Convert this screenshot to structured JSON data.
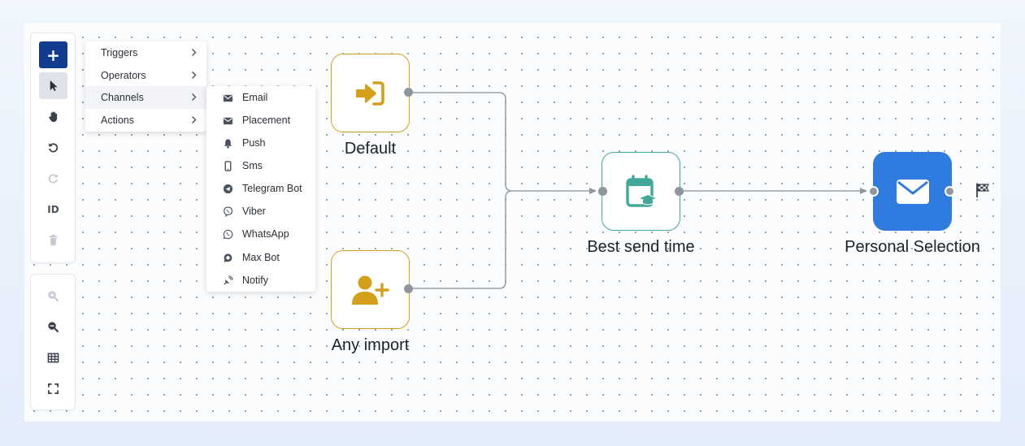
{
  "toolbar": {
    "add_label": "+",
    "id_label": "ID",
    "tools": [
      "add-icon",
      "pointer-icon",
      "hand-icon",
      "undo-icon",
      "redo-icon",
      "id-icon",
      "trash-icon"
    ],
    "view_tools": [
      "zoom-in-icon",
      "zoom-out-icon",
      "grid-icon",
      "fullscreen-icon"
    ]
  },
  "menu": {
    "items": [
      {
        "label": "Triggers"
      },
      {
        "label": "Operators"
      },
      {
        "label": "Channels"
      },
      {
        "label": "Actions"
      }
    ],
    "active_item": "Channels"
  },
  "submenu": {
    "items": [
      {
        "label": "Email",
        "icon": "envelope-icon"
      },
      {
        "label": "Placement",
        "icon": "envelope-icon"
      },
      {
        "label": "Push",
        "icon": "bell-icon"
      },
      {
        "label": "Sms",
        "icon": "phone-icon"
      },
      {
        "label": "Telegram Bot",
        "icon": "telegram-icon"
      },
      {
        "label": "Viber",
        "icon": "viber-icon"
      },
      {
        "label": "WhatsApp",
        "icon": "whatsapp-icon"
      },
      {
        "label": "Max Bot",
        "icon": "chat-bubble-icon"
      },
      {
        "label": "Notify",
        "icon": "satellite-icon"
      }
    ]
  },
  "nodes": {
    "default": {
      "label": "Default",
      "icon": "sign-in-icon",
      "color": "#d4a01c"
    },
    "import": {
      "label": "Any import",
      "icon": "user-plus-icon",
      "color": "#d4a01c"
    },
    "best_time": {
      "label": "Best send time",
      "icon": "calendar-graduation-icon",
      "color": "#42a99a"
    },
    "personal": {
      "label": "Personal Selection",
      "icon": "envelope-icon",
      "color": "#2f7be0"
    }
  },
  "end_marker": "checkered-flag-icon",
  "colors": {
    "primary": "#123c8f",
    "orange": "#d4a01c",
    "teal": "#42a99a",
    "blue": "#2f7be0",
    "wire": "#9aa0a6"
  }
}
